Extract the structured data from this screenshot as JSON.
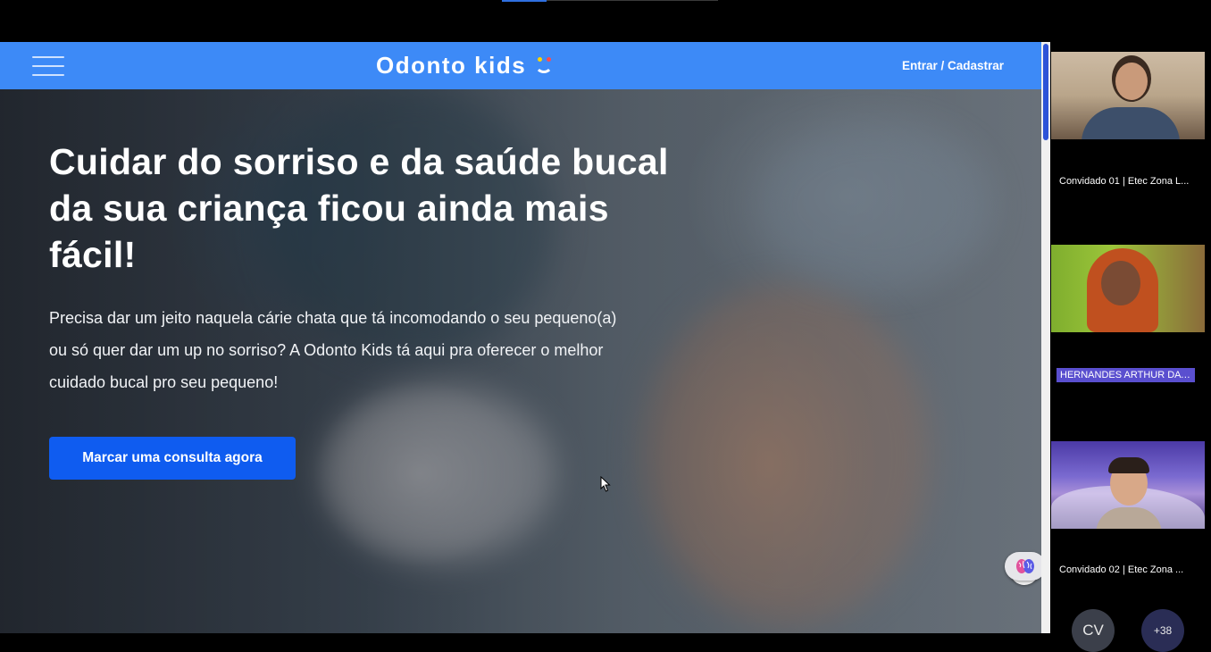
{
  "site": {
    "brand": "Odonto kids",
    "login_label": "Entrar / Cadastrar",
    "headline": "Cuidar do sorriso e da saúde bucal da sua criança ficou ainda mais fácil!",
    "subtext": "Precisa dar um jeito naquela cárie chata que tá incomodando o seu pequeno(a) ou só quer dar um up no sorriso? A Odonto Kids tá aqui pra oferecer o melhor cuidado bucal pro seu pequeno!",
    "cta_label": "Marcar uma consulta agora",
    "colors": {
      "header": "#3d8af7",
      "cta": "#0f5cf0"
    }
  },
  "participants": [
    {
      "name": "Convidado 01 | Etec Zona L...",
      "highlighted": false
    },
    {
      "name": "HERNANDES ARTHUR DA ...",
      "highlighted": true
    },
    {
      "name": "Convidado 02 | Etec Zona ...",
      "highlighted": false
    }
  ],
  "avatars": [
    {
      "initials": "CV"
    },
    {
      "label": "+38"
    }
  ],
  "icons": [
    "hamburger-menu-icon",
    "smile-logo-icon",
    "book-icon",
    "brain-icon",
    "mouse-cursor-icon"
  ]
}
